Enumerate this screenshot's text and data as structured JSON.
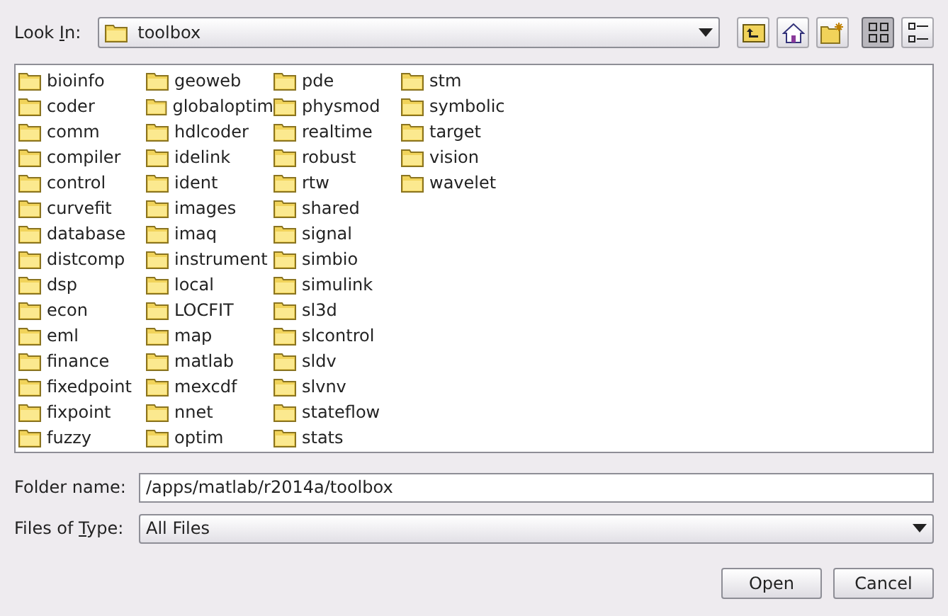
{
  "look_in": {
    "label": {
      "before": "Look ",
      "key": "I",
      "after": "n:"
    },
    "value": "toolbox"
  },
  "toolbar": [
    {
      "kind": "up",
      "selected": false
    },
    {
      "kind": "home",
      "selected": false
    },
    {
      "kind": "new-folder",
      "selected": false
    },
    {
      "kind": "list",
      "selected": true
    },
    {
      "kind": "details",
      "selected": false
    }
  ],
  "folders": [
    [
      "bioinfo",
      "coder",
      "comm",
      "compiler",
      "control",
      "curvefit",
      "database",
      "distcomp",
      "dsp",
      "econ",
      "eml",
      "finance",
      "fixedpoint",
      "fixpoint",
      "fuzzy"
    ],
    [
      "geoweb",
      "globaloptim",
      "hdlcoder",
      "idelink",
      "ident",
      "images",
      "imaq",
      "instrument",
      "local",
      "LOCFIT",
      "map",
      "matlab",
      "mexcdf",
      "nnet",
      "optim"
    ],
    [
      "pde",
      "physmod",
      "realtime",
      "robust",
      "rtw",
      "shared",
      "signal",
      "simbio",
      "simulink",
      "sl3d",
      "slcontrol",
      "sldv",
      "slvnv",
      "stateflow",
      "stats"
    ],
    [
      "stm",
      "symbolic",
      "target",
      "vision",
      "wavelet"
    ]
  ],
  "folder_name": {
    "label": "Folder name:",
    "value": "/apps/matlab/r2014a/toolbox"
  },
  "files_of_type": {
    "label": {
      "before": "Files of ",
      "key": "T",
      "after": "ype:"
    },
    "value": "All Files"
  },
  "buttons": [
    "Open",
    "Cancel"
  ]
}
